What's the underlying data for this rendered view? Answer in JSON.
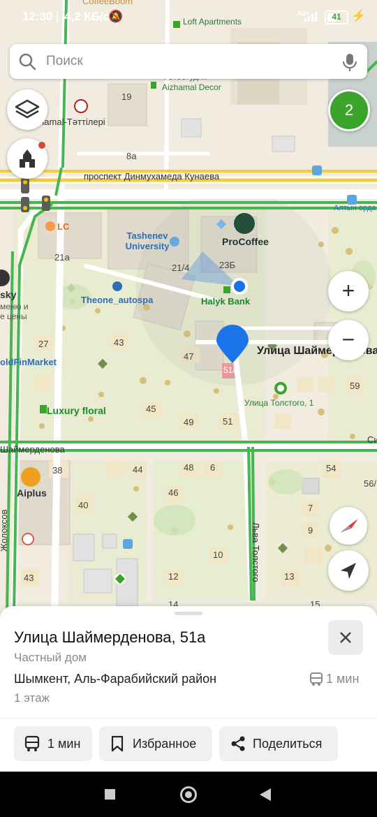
{
  "status_bar": {
    "time": "12:30",
    "speed": "4,2 КБ/с",
    "network": "4G+",
    "battery": "41"
  },
  "search": {
    "placeholder": "Поиск"
  },
  "map": {
    "top_label": "CoffeeBoom",
    "route_badge": "2",
    "roads": {
      "kunaev": "проспект Динмухамеда Кунаева",
      "shaimerdenov_right": "Улица Шаймерденова",
      "shaimerdenov_left": "Шаймерденова",
      "tolstoy": "Льва Толстого",
      "ektokhsov": "Жолоксов",
      "right_edge": "Си"
    },
    "pois": {
      "loft": "Loft Apartments",
      "photo_studio": "Фотостудия",
      "aizhamal": "Aizhamal Decor",
      "aizhamal_tattileri": "Aizhamal-Тәттілері",
      "altyn_orda": "Алтын орда",
      "lc": "LC",
      "tashenev": "Tashenev University",
      "procoffee": "ProCoffee",
      "halyk": "Halyk Bank",
      "theone": "Theone_autospa",
      "sky": "sky",
      "sky_sub1": "меню и",
      "sky_sub2": "е цены",
      "goldfin": "oldFinMarket",
      "luxury": "Luxury floral",
      "tolstoy_stop": "Улица Толстого, 1",
      "aiplus": "Aiplus"
    },
    "buildings": [
      "19",
      "8а",
      "21а",
      "21/4",
      "23Б",
      "27",
      "43",
      "47",
      "51а",
      "45",
      "49",
      "51",
      "59",
      "38",
      "44",
      "48",
      "6",
      "54",
      "56/",
      "40",
      "46",
      "7",
      "9",
      "10",
      "12",
      "13",
      "43",
      "14",
      "15"
    ]
  },
  "controls": {
    "layers_icon": "layers-icon",
    "zoom_in": "+",
    "zoom_out": "−"
  },
  "sheet": {
    "title": "Улица Шаймерденова, 51а",
    "type": "Частный дом",
    "region": "Шымкент, Аль-Фарабийский район",
    "transit_time": "1 мин",
    "floors": "1 этаж",
    "buttons": {
      "route": "1 мин",
      "favorite": "Избранное",
      "share": "Поделиться"
    }
  },
  "colors": {
    "accent_green": "#3aa52a",
    "pin_blue": "#1a73e8",
    "road_yellow": "#f5d34a",
    "road_green": "#4cbb55"
  }
}
